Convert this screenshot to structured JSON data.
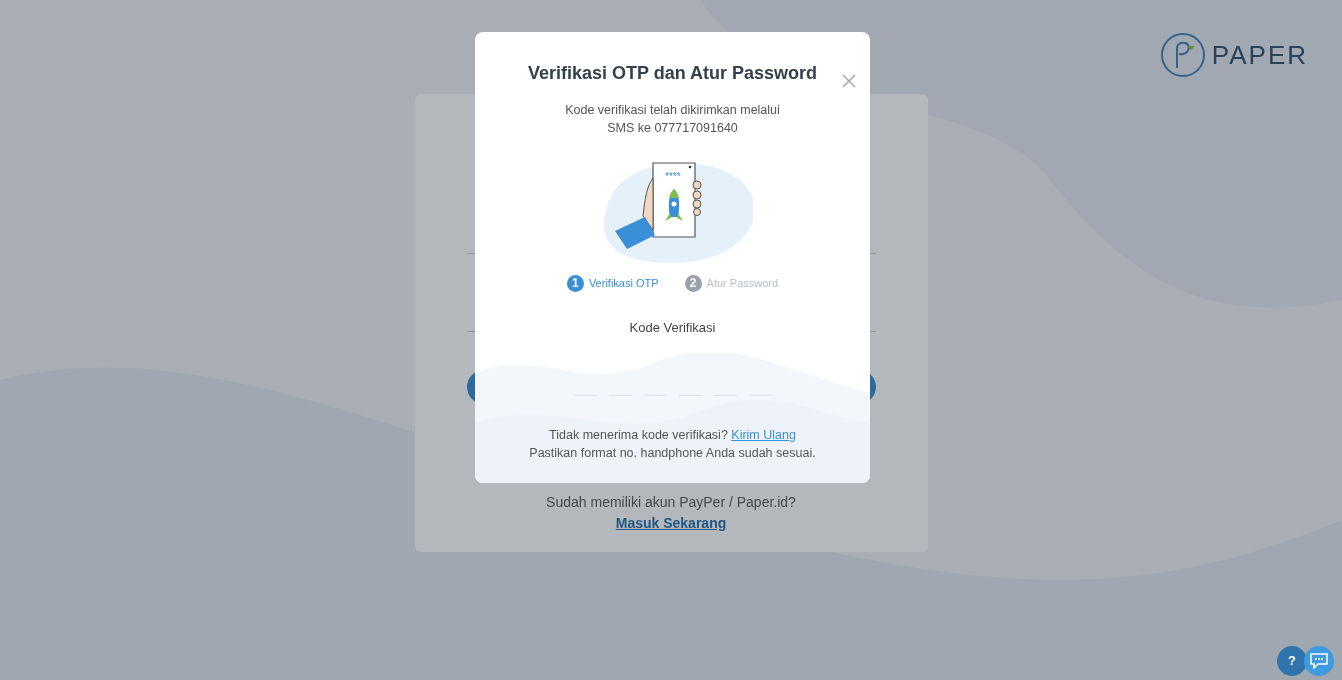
{
  "background_page": {
    "login_prompt": "Sudah memiliki akun PayPer / Paper.id?",
    "login_link": "Masuk Sekarang"
  },
  "logo": {
    "text": "PAPER"
  },
  "modal": {
    "title": "Verifikasi OTP dan Atur Password",
    "message_lines": [
      "Kode verifikasi telah dikirimkan melalui",
      "SMS ke 077717091640"
    ],
    "illustration_text": "****",
    "steps": [
      {
        "number": "1",
        "label": "Verifikasi OTP",
        "selected": true
      },
      {
        "number": "2",
        "label": "Atur Password",
        "selected": false
      }
    ],
    "code_label": "Kode Verifikasi",
    "code_slots": [
      {
        "filled": false
      },
      {
        "filled": false
      },
      {
        "filled": false
      },
      {
        "filled": false
      },
      {
        "filled": false
      },
      {
        "filled": false
      }
    ],
    "resend_prompt": "Tidak menerima kode verifikasi?",
    "resend_link": "Kirim Ulang",
    "hint": "Pastikan format no. handphone Anda sudah sesuai."
  },
  "help_buttons": [
    {
      "kind": "help",
      "text": "?"
    },
    {
      "kind": "chat"
    }
  ]
}
